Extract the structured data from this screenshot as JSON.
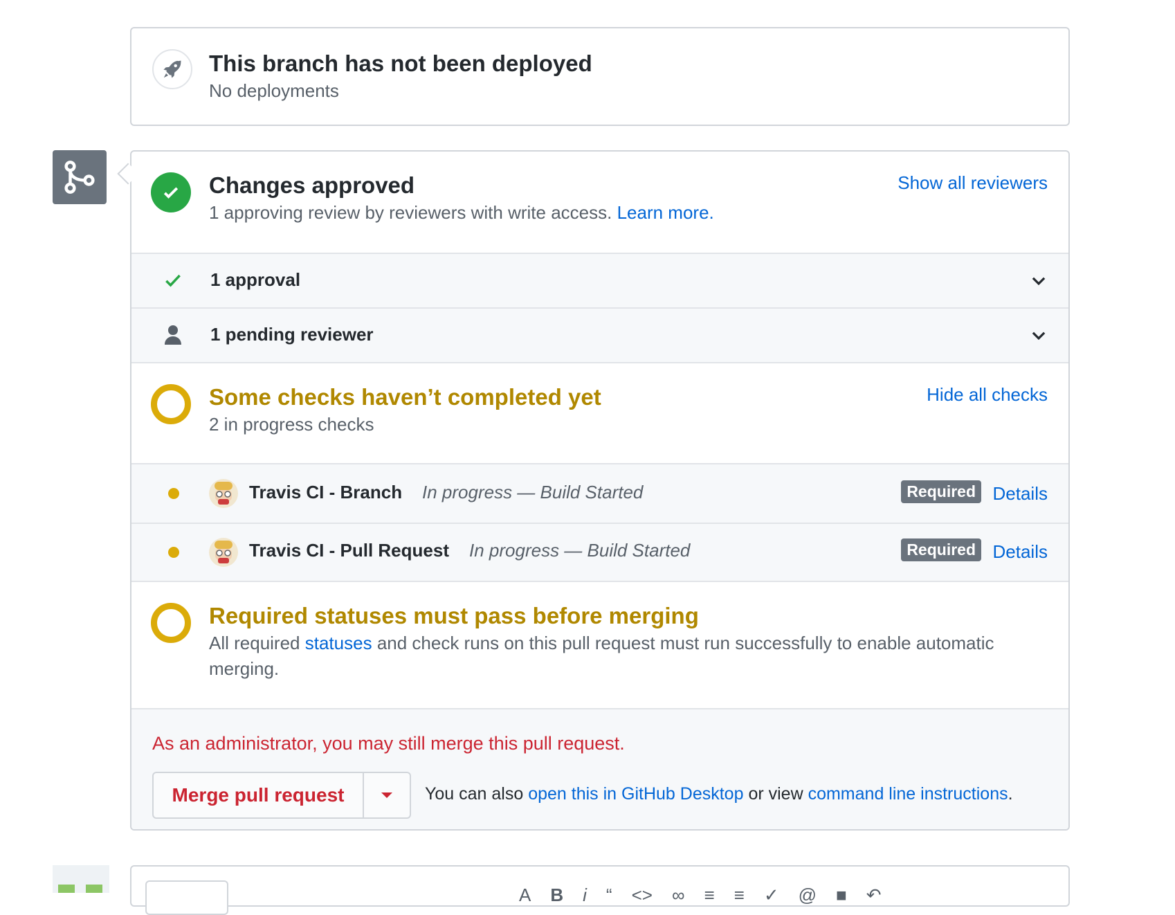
{
  "deploy": {
    "title": "This branch has not been deployed",
    "subtitle": "No deployments",
    "icon": "rocket-icon"
  },
  "review": {
    "title": "Changes approved",
    "subtitle": "1 approving review by reviewers with write access.",
    "learn_more": "Learn more.",
    "show_reviewers": "Show all reviewers",
    "approval_label": "1 approval",
    "pending_label": "1 pending reviewer"
  },
  "checks": {
    "title": "Some checks haven’t completed yet",
    "subtitle": "2 in progress checks",
    "hide_link": "Hide all checks",
    "items": [
      {
        "name": "Travis CI - Branch",
        "status": "In progress — Build Started",
        "badge": "Required",
        "details": "Details"
      },
      {
        "name": "Travis CI - Pull Request",
        "status": "In progress — Build Started",
        "badge": "Required",
        "details": "Details"
      }
    ]
  },
  "required": {
    "title": "Required statuses must pass before merging",
    "desc_prefix": "All required",
    "desc_link": "statuses",
    "desc_suffix": "and check runs on this pull request must run successfully to enable automatic merging."
  },
  "merge": {
    "admin_text": "As an administrator, you may still merge this pull request.",
    "button_label": "Merge pull request",
    "also_prefix": "You can also",
    "desktop_link": "open this in GitHub Desktop",
    "or_view": "or view",
    "cli_link": "command line instructions",
    "period": "."
  },
  "colors": {
    "success": "#28a745",
    "pending": "#dbab09",
    "danger": "#cb2431",
    "link": "#0366d6"
  }
}
